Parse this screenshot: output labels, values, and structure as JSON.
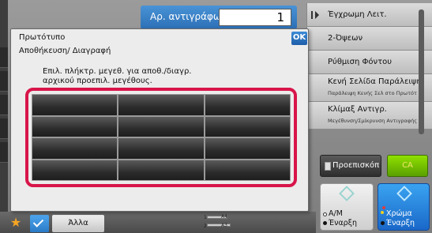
{
  "copies": {
    "label": "Αρ. αντιγράφων",
    "value": "1"
  },
  "right_menu": {
    "items": [
      {
        "label": "Έγχρωμη Λειτ.",
        "sub": ""
      },
      {
        "label": "2-Όψεων",
        "sub": ""
      },
      {
        "label": "Ρύθμιση Φόντου",
        "sub": ""
      },
      {
        "label": "Κενή Σελίδα Παράλειψη",
        "sub": "Παράλειψη Κενής Σελ στο Πρωτότ"
      },
      {
        "label": "Κλίμαξ Αντιγρ.",
        "sub": "Μεγέθυνση/Σμίκρυνση Αντιγραφής"
      }
    ]
  },
  "preview": {
    "label": "Προεπισκόπ"
  },
  "ca": {
    "label": "CA"
  },
  "start_bw": {
    "line1": "Α/Μ",
    "line2": "Έναρξη"
  },
  "start_color": {
    "line1": "Χρώμα",
    "line2": "Έναρξη"
  },
  "bottom": {
    "other_label": "Άλλα",
    "tray_a4": "A4",
    "tray_a3": "A3",
    "tray_num": "1",
    "tray_num2": "2"
  },
  "dialog": {
    "title": "Πρωτότυπο",
    "subtitle": "Αποθήκευση/ Διαγραφή",
    "ok_label": "OK",
    "instruction_line1": "Επιλ. πλήκτρ. μεγεθ. για αποθ./διαγρ.",
    "instruction_line2": "αρχικού προεπιλ. μεγέθους.",
    "keys": [
      "",
      "",
      "",
      "",
      "",
      "",
      "",
      "",
      "",
      "",
      "",
      ""
    ]
  },
  "colors": {
    "highlight": "#d8154a",
    "accent_blue": "#2c6fb6",
    "ca_green": "#6fbf00"
  }
}
